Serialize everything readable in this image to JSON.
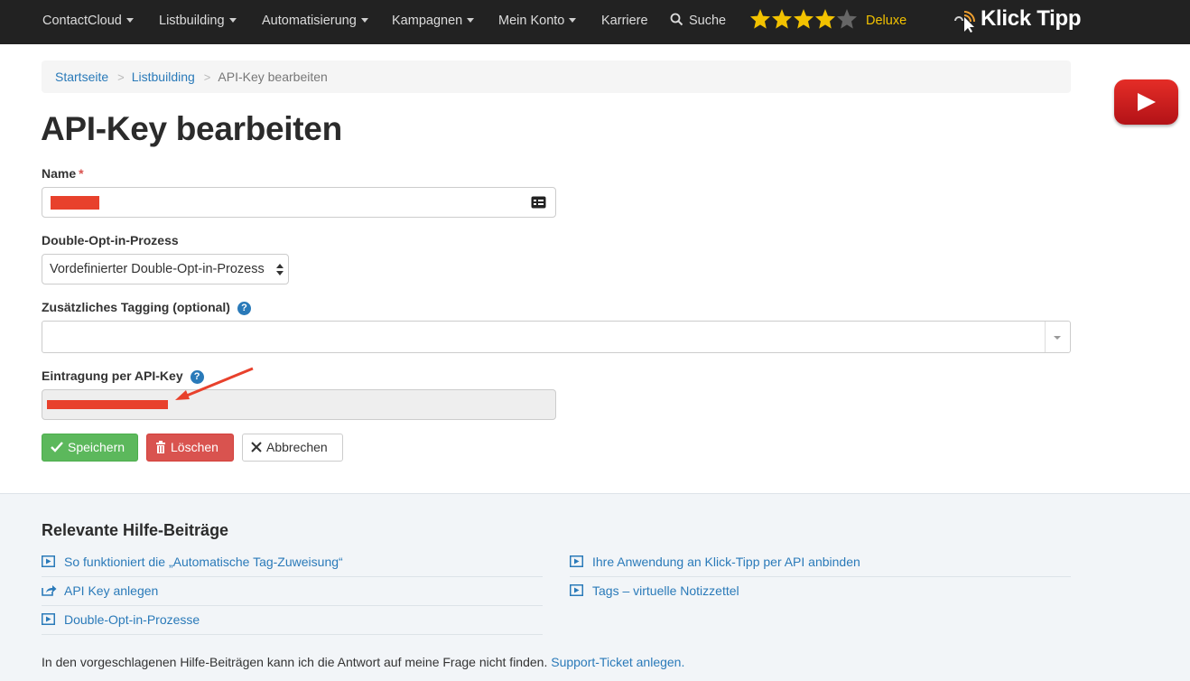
{
  "nav": {
    "items": [
      {
        "label": "ContactCloud",
        "dropdown": true
      },
      {
        "label": "Listbuilding",
        "dropdown": true
      },
      {
        "label": "Automatisierung",
        "dropdown": true
      },
      {
        "label": "Kampagnen",
        "dropdown": true
      },
      {
        "label": "Mein Konto",
        "dropdown": true
      },
      {
        "label": "Karriere",
        "dropdown": false
      }
    ],
    "search_label": "Suche",
    "rating": {
      "filled": 4,
      "total": 5
    },
    "plan_label": "Deluxe",
    "logo_text": "Klick Tipp"
  },
  "breadcrumb": {
    "items": [
      "Startseite",
      "Listbuilding"
    ],
    "current": "API-Key bearbeiten"
  },
  "page_title": "API-Key bearbeiten",
  "form": {
    "name_label": "Name",
    "required_mark": "*",
    "doi_label": "Double-Opt-in-Prozess",
    "doi_value": "Vordefinierter Double-Opt-in-Prozess",
    "tagging_label": "Zusätzliches Tagging (optional)",
    "apikey_label": "Eintragung per API-Key",
    "help_glyph": "?"
  },
  "buttons": {
    "save": "Speichern",
    "delete": "Löschen",
    "cancel": "Abbrechen"
  },
  "help": {
    "title": "Relevante Hilfe-Beiträge",
    "left_links": [
      {
        "label": "So funktioniert die „Automatische Tag-Zuweisung“",
        "icon": "video-icon"
      },
      {
        "label": "API Key anlegen",
        "icon": "share-icon"
      },
      {
        "label": "Double-Opt-in-Prozesse",
        "icon": "video-icon"
      }
    ],
    "right_links": [
      {
        "label": "Ihre Anwendung an Klick-Tipp per API anbinden",
        "icon": "video-icon"
      },
      {
        "label": "Tags – virtuelle Notizzettel",
        "icon": "video-icon"
      }
    ],
    "footer_text": "In den vorgeschlagenen Hilfe-Beiträgen kann ich die Antwort auf meine Frage nicht finden.",
    "footer_link": "Support-Ticket anlegen."
  },
  "colors": {
    "nav_bg": "#222222",
    "link": "#2a7ab9",
    "star": "#f2c200",
    "save": "#5cb85c",
    "delete": "#d9534f",
    "redaction": "#e8412c"
  }
}
